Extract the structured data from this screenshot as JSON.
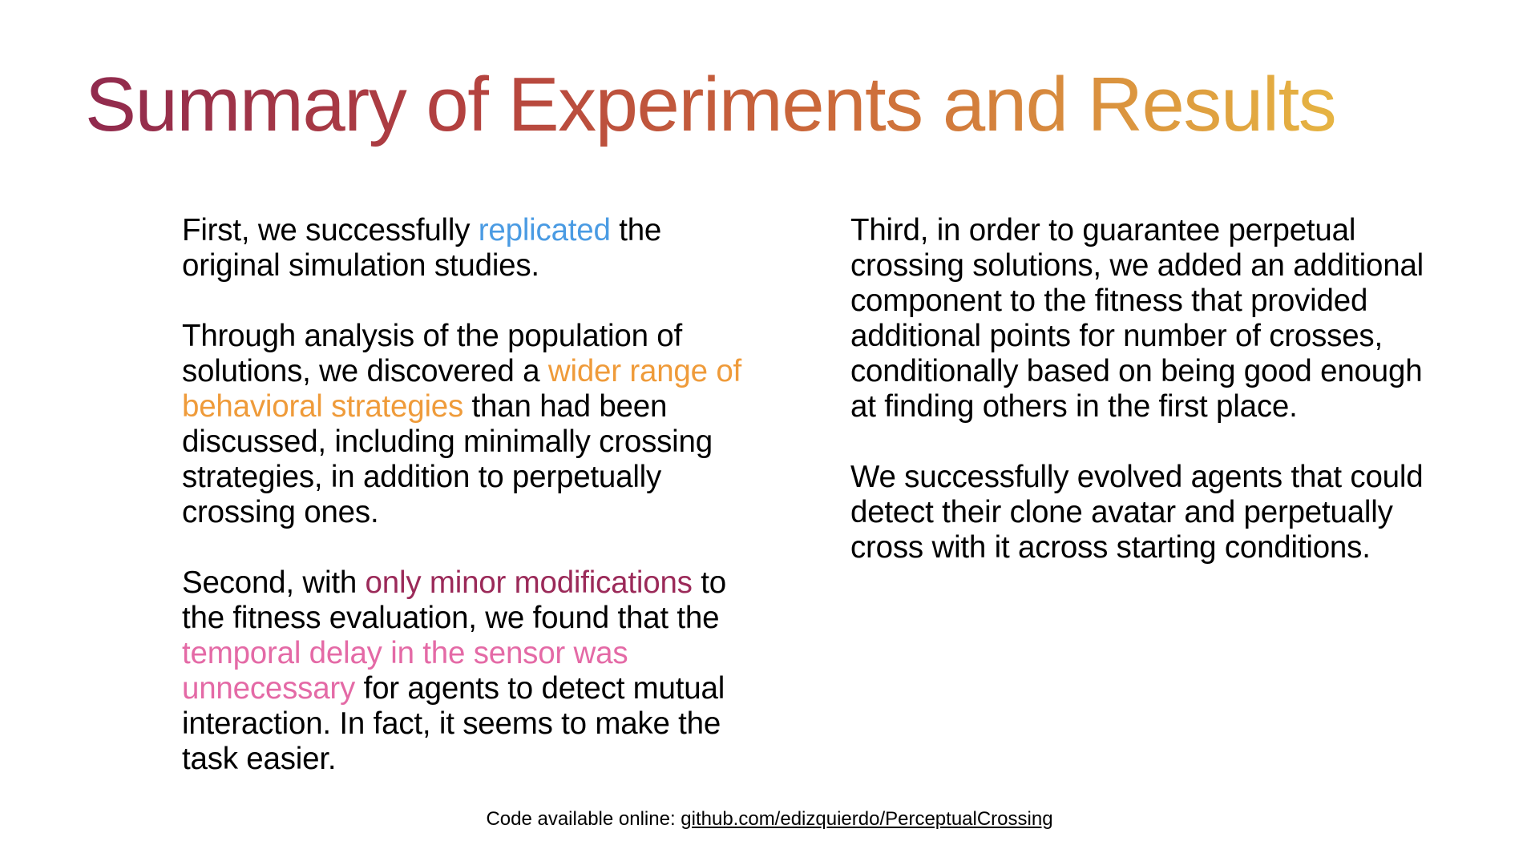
{
  "slide": {
    "title": "Summary of Experiments and Results",
    "left_column": {
      "p1": {
        "before": "First, we successfully ",
        "highlight": "replicated",
        "after": " the original simulation studies."
      },
      "p2": {
        "before": "Through analysis of the population of solutions, we discovered a ",
        "highlight": "wider range of behavioral strategies",
        "after": " than had been discussed, including minimally crossing strategies, in addition to perpetually crossing ones."
      },
      "p3": {
        "before": "Second, with ",
        "highlight1": "only minor modifications",
        "middle": " to the fitness evaluation, we found that the ",
        "highlight2": "temporal delay in the sensor was unnecessary",
        "after": " for agents to detect mutual interaction. In fact, it seems to make the task easier."
      }
    },
    "right_column": {
      "p1": "Third, in order to guarantee perpetual crossing solutions, we added an additional component to the fitness that provided additional points for number of crosses, conditionally based on being good enough at finding others in the first place.",
      "p2": "We successfully evolved agents that could detect their clone avatar and perpetually cross with it across starting conditions."
    },
    "footer": {
      "label": "Code available online: ",
      "link": "github.com/edizquierdo/PerceptualCrossing"
    }
  },
  "colors": {
    "title_gradient_start": "#902a4e",
    "title_gradient_end": "#e6b442",
    "highlight_blue": "#4a9be3",
    "highlight_orange": "#ef9b3a",
    "highlight_maroon": "#9b2a59",
    "highlight_pink": "#e46aa6"
  }
}
